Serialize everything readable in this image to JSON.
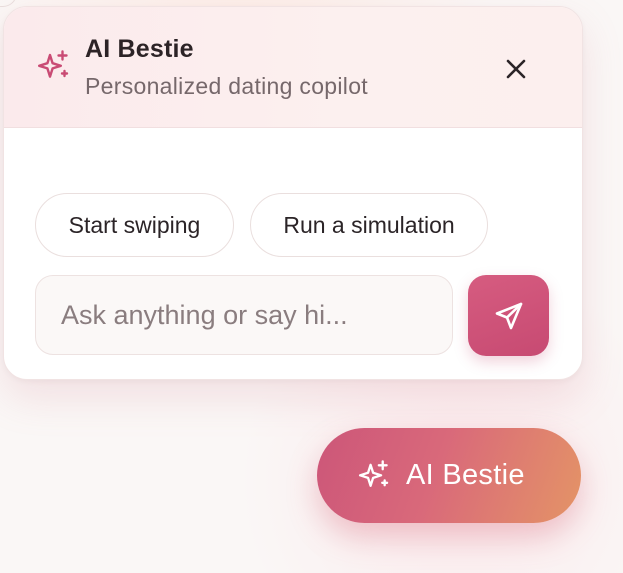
{
  "panel": {
    "title": "AI Bestie",
    "subtitle": "Personalized dating copilot",
    "title_icon": "sparkle-icon",
    "close_icon": "close-icon"
  },
  "suggestions": [
    {
      "label": "Start swiping"
    },
    {
      "label": "Run a simulation"
    }
  ],
  "composer": {
    "placeholder": "Ask anything or say hi...",
    "value": "",
    "send_icon": "send-icon"
  },
  "launcher": {
    "label": "AI Bestie",
    "icon": "sparkle-icon"
  },
  "colors": {
    "accent": "#c74a72",
    "accent_gradient_start": "#cc5679",
    "accent_gradient_end": "#e49466",
    "header_bg": "#fbeaec"
  }
}
